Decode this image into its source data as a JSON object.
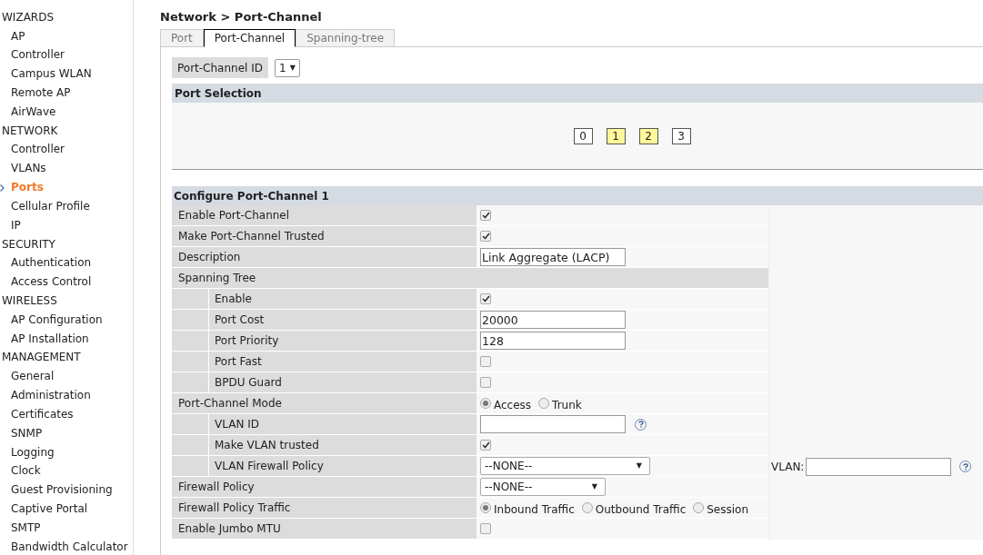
{
  "sidebar": {
    "groups": [
      {
        "title": "WIZARDS",
        "items": [
          {
            "label": "AP",
            "selected": false
          },
          {
            "label": "Controller",
            "selected": false
          },
          {
            "label": "Campus WLAN",
            "selected": false
          },
          {
            "label": "Remote AP",
            "selected": false
          },
          {
            "label": "AirWave",
            "selected": false
          }
        ]
      },
      {
        "title": "NETWORK",
        "items": [
          {
            "label": "Controller",
            "selected": false
          },
          {
            "label": "VLANs",
            "selected": false
          },
          {
            "label": "Ports",
            "selected": true
          },
          {
            "label": "Cellular Profile",
            "selected": false
          },
          {
            "label": "IP",
            "selected": false
          }
        ]
      },
      {
        "title": "SECURITY",
        "items": [
          {
            "label": "Authentication",
            "selected": false
          },
          {
            "label": "Access Control",
            "selected": false
          }
        ]
      },
      {
        "title": "WIRELESS",
        "items": [
          {
            "label": "AP Configuration",
            "selected": false
          },
          {
            "label": "AP Installation",
            "selected": false
          }
        ]
      },
      {
        "title": "MANAGEMENT",
        "items": [
          {
            "label": "General",
            "selected": false
          },
          {
            "label": "Administration",
            "selected": false
          },
          {
            "label": "Certificates",
            "selected": false
          },
          {
            "label": "SNMP",
            "selected": false
          },
          {
            "label": "Logging",
            "selected": false
          },
          {
            "label": "Clock",
            "selected": false
          },
          {
            "label": "Guest Provisioning",
            "selected": false
          },
          {
            "label": "Captive Portal",
            "selected": false
          },
          {
            "label": "SMTP",
            "selected": false
          },
          {
            "label": "Bandwidth Calculator",
            "selected": false
          }
        ]
      }
    ]
  },
  "breadcrumb": "Network > Port-Channel",
  "tabs": [
    {
      "label": "Port",
      "selected": false
    },
    {
      "label": "Port-Channel",
      "selected": true
    },
    {
      "label": "Spanning-tree",
      "selected": false
    }
  ],
  "port_channel_id": {
    "label": "Port-Channel ID",
    "value": "1",
    "arrow": "▼"
  },
  "port_selection": {
    "title": "Port Selection",
    "ports": [
      {
        "label": "0",
        "selected": false
      },
      {
        "label": "1",
        "selected": true
      },
      {
        "label": "2",
        "selected": true
      },
      {
        "label": "3",
        "selected": false
      }
    ]
  },
  "configure": {
    "title": "Configure Port-Channel 1",
    "rows": [
      {
        "kind": "checkbox",
        "label": "Enable Port-Channel",
        "checked": true
      },
      {
        "kind": "checkbox",
        "label": "Make Port-Channel Trusted",
        "checked": true
      },
      {
        "kind": "text",
        "label": "Description",
        "value": "Link Aggregate (LACP)"
      },
      {
        "kind": "section",
        "label": "Spanning Tree",
        "children": [
          {
            "kind": "checkbox",
            "label": "Enable",
            "checked": true
          },
          {
            "kind": "text",
            "label": "Port Cost",
            "value": "20000"
          },
          {
            "kind": "text",
            "label": "Port Priority",
            "value": "128"
          },
          {
            "kind": "checkbox",
            "label": "Port Fast",
            "checked": false
          },
          {
            "kind": "checkbox",
            "label": "BPDU Guard",
            "checked": false
          }
        ]
      },
      {
        "kind": "radio",
        "label": "Port-Channel Mode",
        "options": [
          {
            "label": "Access",
            "selected": true
          },
          {
            "label": "Trunk",
            "selected": false
          }
        ],
        "children": [
          {
            "kind": "text",
            "label": "VLAN ID",
            "help": true
          },
          {
            "kind": "checkbox",
            "label": "Make VLAN trusted",
            "checked": true
          },
          {
            "kind": "select",
            "label": "VLAN Firewall Policy",
            "value": "--NONE--",
            "arrow": "▼",
            "wide": true,
            "extra": {
              "label": "VLAN:",
              "help": true
            }
          }
        ]
      },
      {
        "kind": "select",
        "label": "Firewall Policy",
        "value": "--NONE--",
        "arrow": "▼"
      },
      {
        "kind": "radio",
        "label": "Firewall Policy Traffic",
        "options": [
          {
            "label": "Inbound Traffic",
            "selected": true
          },
          {
            "label": "Outbound Traffic",
            "selected": false
          },
          {
            "label": "Session",
            "selected": false
          }
        ]
      },
      {
        "kind": "checkbox",
        "label": "Enable Jumbo MTU",
        "checked": false
      }
    ]
  }
}
